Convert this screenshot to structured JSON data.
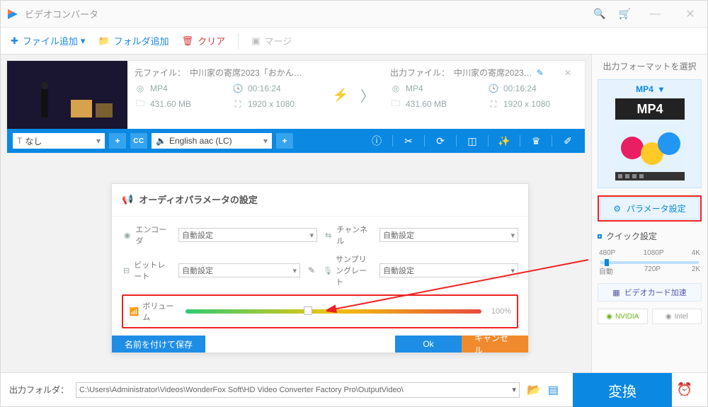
{
  "window": {
    "title": "ビデオコンバータ"
  },
  "toolbar": {
    "add_file": "ファイル追加",
    "add_folder": "フォルダ追加",
    "clear": "クリア",
    "merge": "マージ"
  },
  "file": {
    "src_label": "元ファイル：",
    "src_name": "中川家の寄席2023「おかん…",
    "dst_label": "出力ファイル：",
    "dst_name": "中川家の寄席2023…",
    "fmt": "MP4",
    "dur": "00:16:24",
    "size": "431.60 MB",
    "res": "1920 x 1080",
    "track_none": "なし",
    "audio_track": "English aac (LC)"
  },
  "panel": {
    "title": "オーディオパラメータの設定",
    "encoder": "エンコーダ",
    "channel": "チャンネル",
    "bitrate": "ビットレート",
    "sample": "サンプリングレート",
    "volume": "ボリューム",
    "auto": "自動設定",
    "vol_pct": "100%",
    "save": "名前を付けて保存",
    "ok": "Ok",
    "cancel": "キャンセル"
  },
  "side": {
    "title": "出力フォーマットを選択",
    "fmt": "MP4",
    "param": "パラメータ設定",
    "quick": "クイック設定",
    "res": {
      "r1": "480P",
      "r2": "1080P",
      "r3": "4K",
      "r4": "自動",
      "r5": "720P",
      "r6": "2K"
    },
    "gpu": "ビデオカード加速",
    "nvidia": "NVIDIA",
    "intel": "Intel"
  },
  "bottom": {
    "label": "出力フォルダ：",
    "path": "C:\\Users\\Administrator\\Videos\\WonderFox Soft\\HD Video Converter Factory Pro\\OutputVideo\\",
    "convert": "変換"
  }
}
